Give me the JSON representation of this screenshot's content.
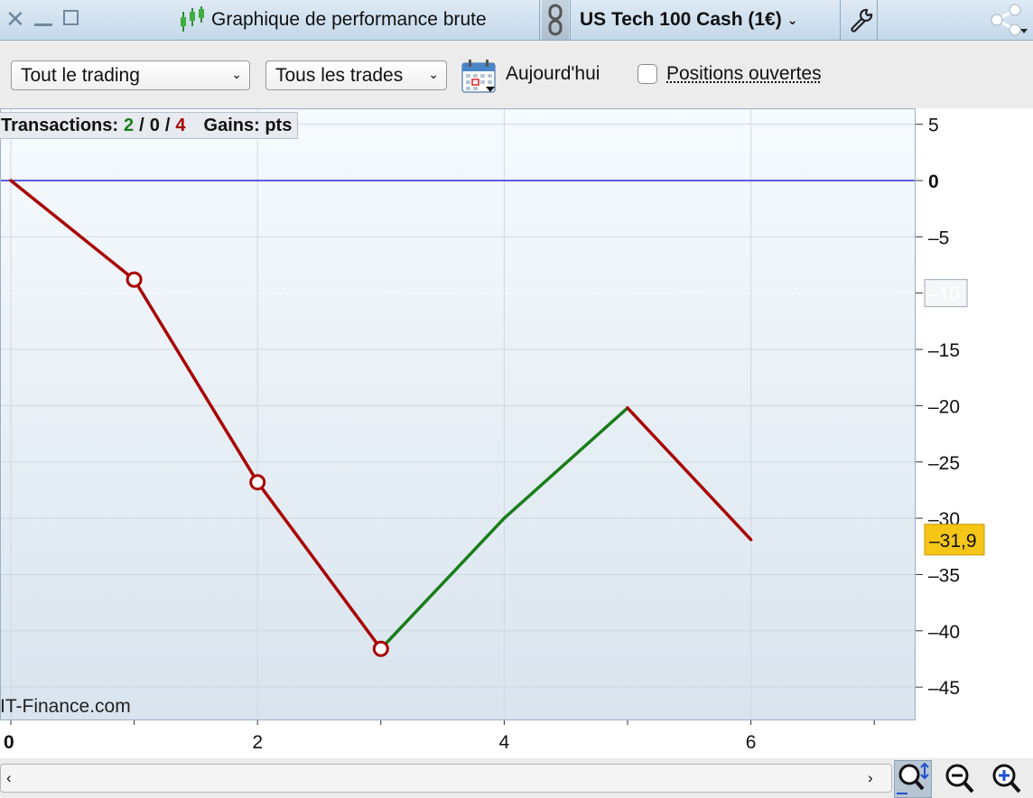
{
  "window": {
    "title": "Graphique de performance brute",
    "instrument": "US Tech 100 Cash (1€)"
  },
  "toolbar": {
    "trading_filter": "Tout le trading",
    "trades_filter": "Tous les trades",
    "date_label": "Aujourd'hui",
    "open_positions_label": "Positions ouvertes",
    "open_positions_checked": false
  },
  "stats": {
    "transactions_label": "Transactions:",
    "wins": "2",
    "sep1": "/",
    "neutral": "0",
    "sep2": "/",
    "losses": "4",
    "gains_label": "Gains: pts"
  },
  "watermark": "IT-Finance.com",
  "colors": {
    "win": "#1a7d1a",
    "loss": "#a80000",
    "zero_line": "#2b2bd6",
    "last_value_badge": "#f5c518"
  },
  "chart_data": {
    "type": "line",
    "x": [
      0,
      1,
      2,
      3,
      4,
      5,
      6
    ],
    "y": [
      0,
      -8.8,
      -26.8,
      -41.6,
      -30,
      -20.2,
      -31.9
    ],
    "segment_result": [
      "loss",
      "loss",
      "loss",
      "win",
      "win",
      "loss"
    ],
    "markers_at": [
      1,
      2,
      3
    ],
    "xlim": [
      0,
      7.3
    ],
    "ylim": [
      -48,
      6
    ],
    "x_ticks": [
      "0",
      "2",
      "4",
      "6"
    ],
    "y_ticks": [
      "5",
      "0",
      "-5",
      "-10",
      "-15",
      "-20",
      "-25",
      "-30",
      "-35",
      "-40",
      "-45"
    ],
    "highlight_tick": "-10",
    "last_value": "-31,9",
    "grid": true
  }
}
